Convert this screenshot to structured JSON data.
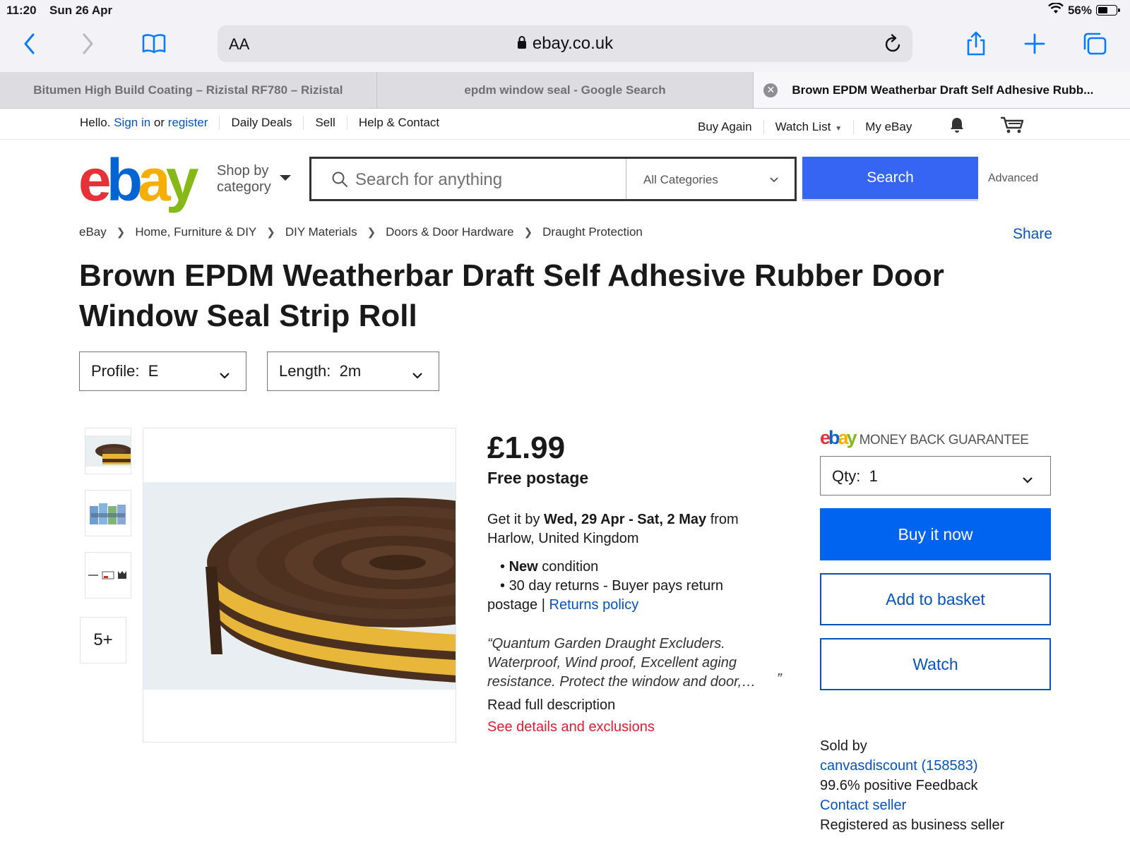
{
  "status_bar": {
    "time": "11:20",
    "date": "Sun 26 Apr",
    "battery": "56%",
    "battery_level": 0.56
  },
  "browser": {
    "text_size_label": "AA",
    "url_host": "ebay.co.uk",
    "icons": [
      "chevron-left-icon",
      "chevron-right-icon",
      "bookmarks-icon",
      "lock-icon",
      "reload-icon",
      "share-icon",
      "plus-icon",
      "tabs-icon"
    ],
    "tabs": [
      {
        "label": "Bitumen High Build Coating – Rizistal RF780 – Rizistal"
      },
      {
        "label": "epdm window seal - Google Search"
      },
      {
        "label": "Brown EPDM Weatherbar Draft Self Adhesive Rubb..."
      }
    ]
  },
  "header": {
    "hello": "Hello.",
    "sign_in": "Sign in",
    "or": "or",
    "register": "register",
    "daily_deals": "Daily Deals",
    "sell": "Sell",
    "help": "Help & Contact",
    "buy_again": "Buy Again",
    "watch_list": "Watch List",
    "my_ebay": "My eBay"
  },
  "search": {
    "shop_by_line1": "Shop by",
    "shop_by_line2": "category",
    "placeholder": "Search for anything",
    "category": "All Categories",
    "button": "Search",
    "advanced": "Advanced"
  },
  "breadcrumb": [
    "eBay",
    "Home, Furniture & DIY",
    "DIY Materials",
    "Doors & Door Hardware",
    "Draught Protection"
  ],
  "share": "Share",
  "product": {
    "title": "Brown EPDM Weatherbar Draft Self Adhesive Rubber Door Window Seal Strip Roll",
    "profile_label": "Profile:",
    "profile_value": "E",
    "length_label": "Length:",
    "length_value": "2m",
    "more_images": "5+",
    "price": "£1.99",
    "postage": "Free postage",
    "delivery_prefix": "Get it by",
    "delivery_dates": "Wed, 29 Apr - Sat, 2 May",
    "delivery_from": "from",
    "delivery_location": "Harlow, United Kingdom",
    "condition_bold": "New",
    "condition_rest": "condition",
    "returns_text": "30 day returns - Buyer pays return",
    "returns_text2": "postage |",
    "returns_link": "Returns policy",
    "quote_text": "“Quantum Garden Draught Excluders. Waterproof, Wind proof, Excellent aging resistance. Protect the window and door,…",
    "quote_close": "”",
    "read_more": "Read full description",
    "see_details": "See details and exclusions"
  },
  "buy_box": {
    "mbg_text": "MONEY BACK GUARANTEE",
    "qty_label": "Qty:",
    "qty_value": "1",
    "buy_now": "Buy it now",
    "add_to_basket": "Add to basket",
    "watch": "Watch"
  },
  "seller": {
    "sold_by": "Sold by",
    "name": "canvasdiscount",
    "feedback_count": "158583",
    "feedback_percent": "99.6% positive Feedback",
    "contact": "Contact seller",
    "registered": "Registered as business seller"
  },
  "colors": {
    "link": "#0654ba",
    "primary_button": "#0064f0",
    "search_button": "#3665f3",
    "alert_red": "#dd1e31",
    "ebay_red": "#e53238",
    "ebay_blue": "#0064d2",
    "ebay_yellow": "#f5af02",
    "ebay_green": "#86b817"
  }
}
